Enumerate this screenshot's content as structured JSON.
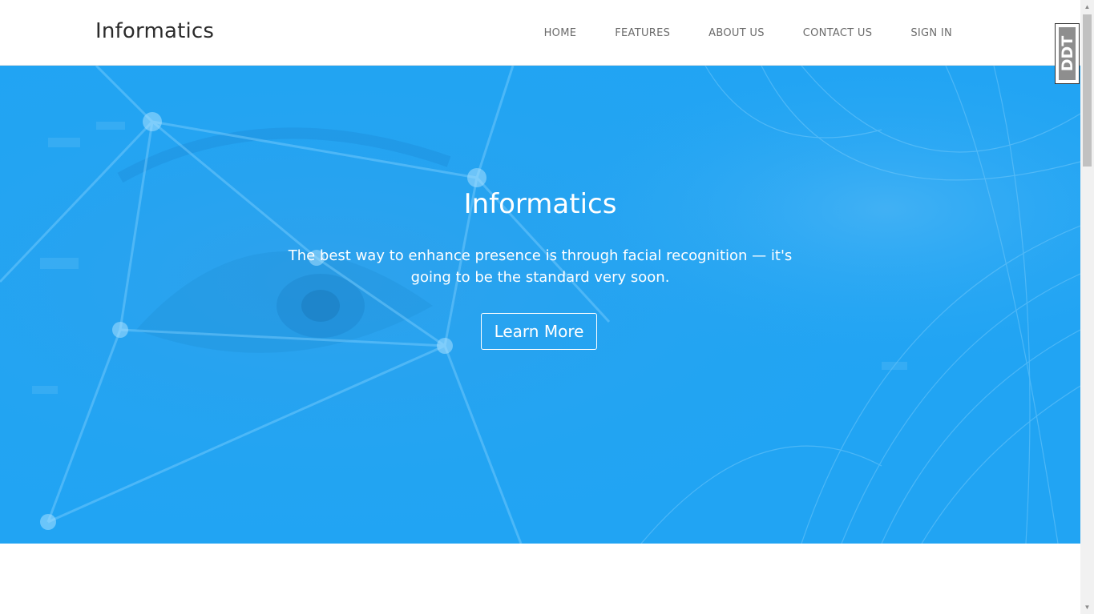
{
  "navbar": {
    "brand": "Informatics",
    "links": [
      "HOME",
      "FEATURES",
      "ABOUT US",
      "CONTACT US",
      "SIGN IN"
    ]
  },
  "hero": {
    "title": "Informatics",
    "text": "The best way to enhance presence is through facial recognition — it's going to be the standard very soon.",
    "button": "Learn More",
    "background_color": "#21a4f3"
  },
  "extension_widget": {
    "label": "DDT"
  },
  "scrollbar": {
    "up_icon": "chevron-up-icon",
    "down_icon": "chevron-down-icon"
  }
}
